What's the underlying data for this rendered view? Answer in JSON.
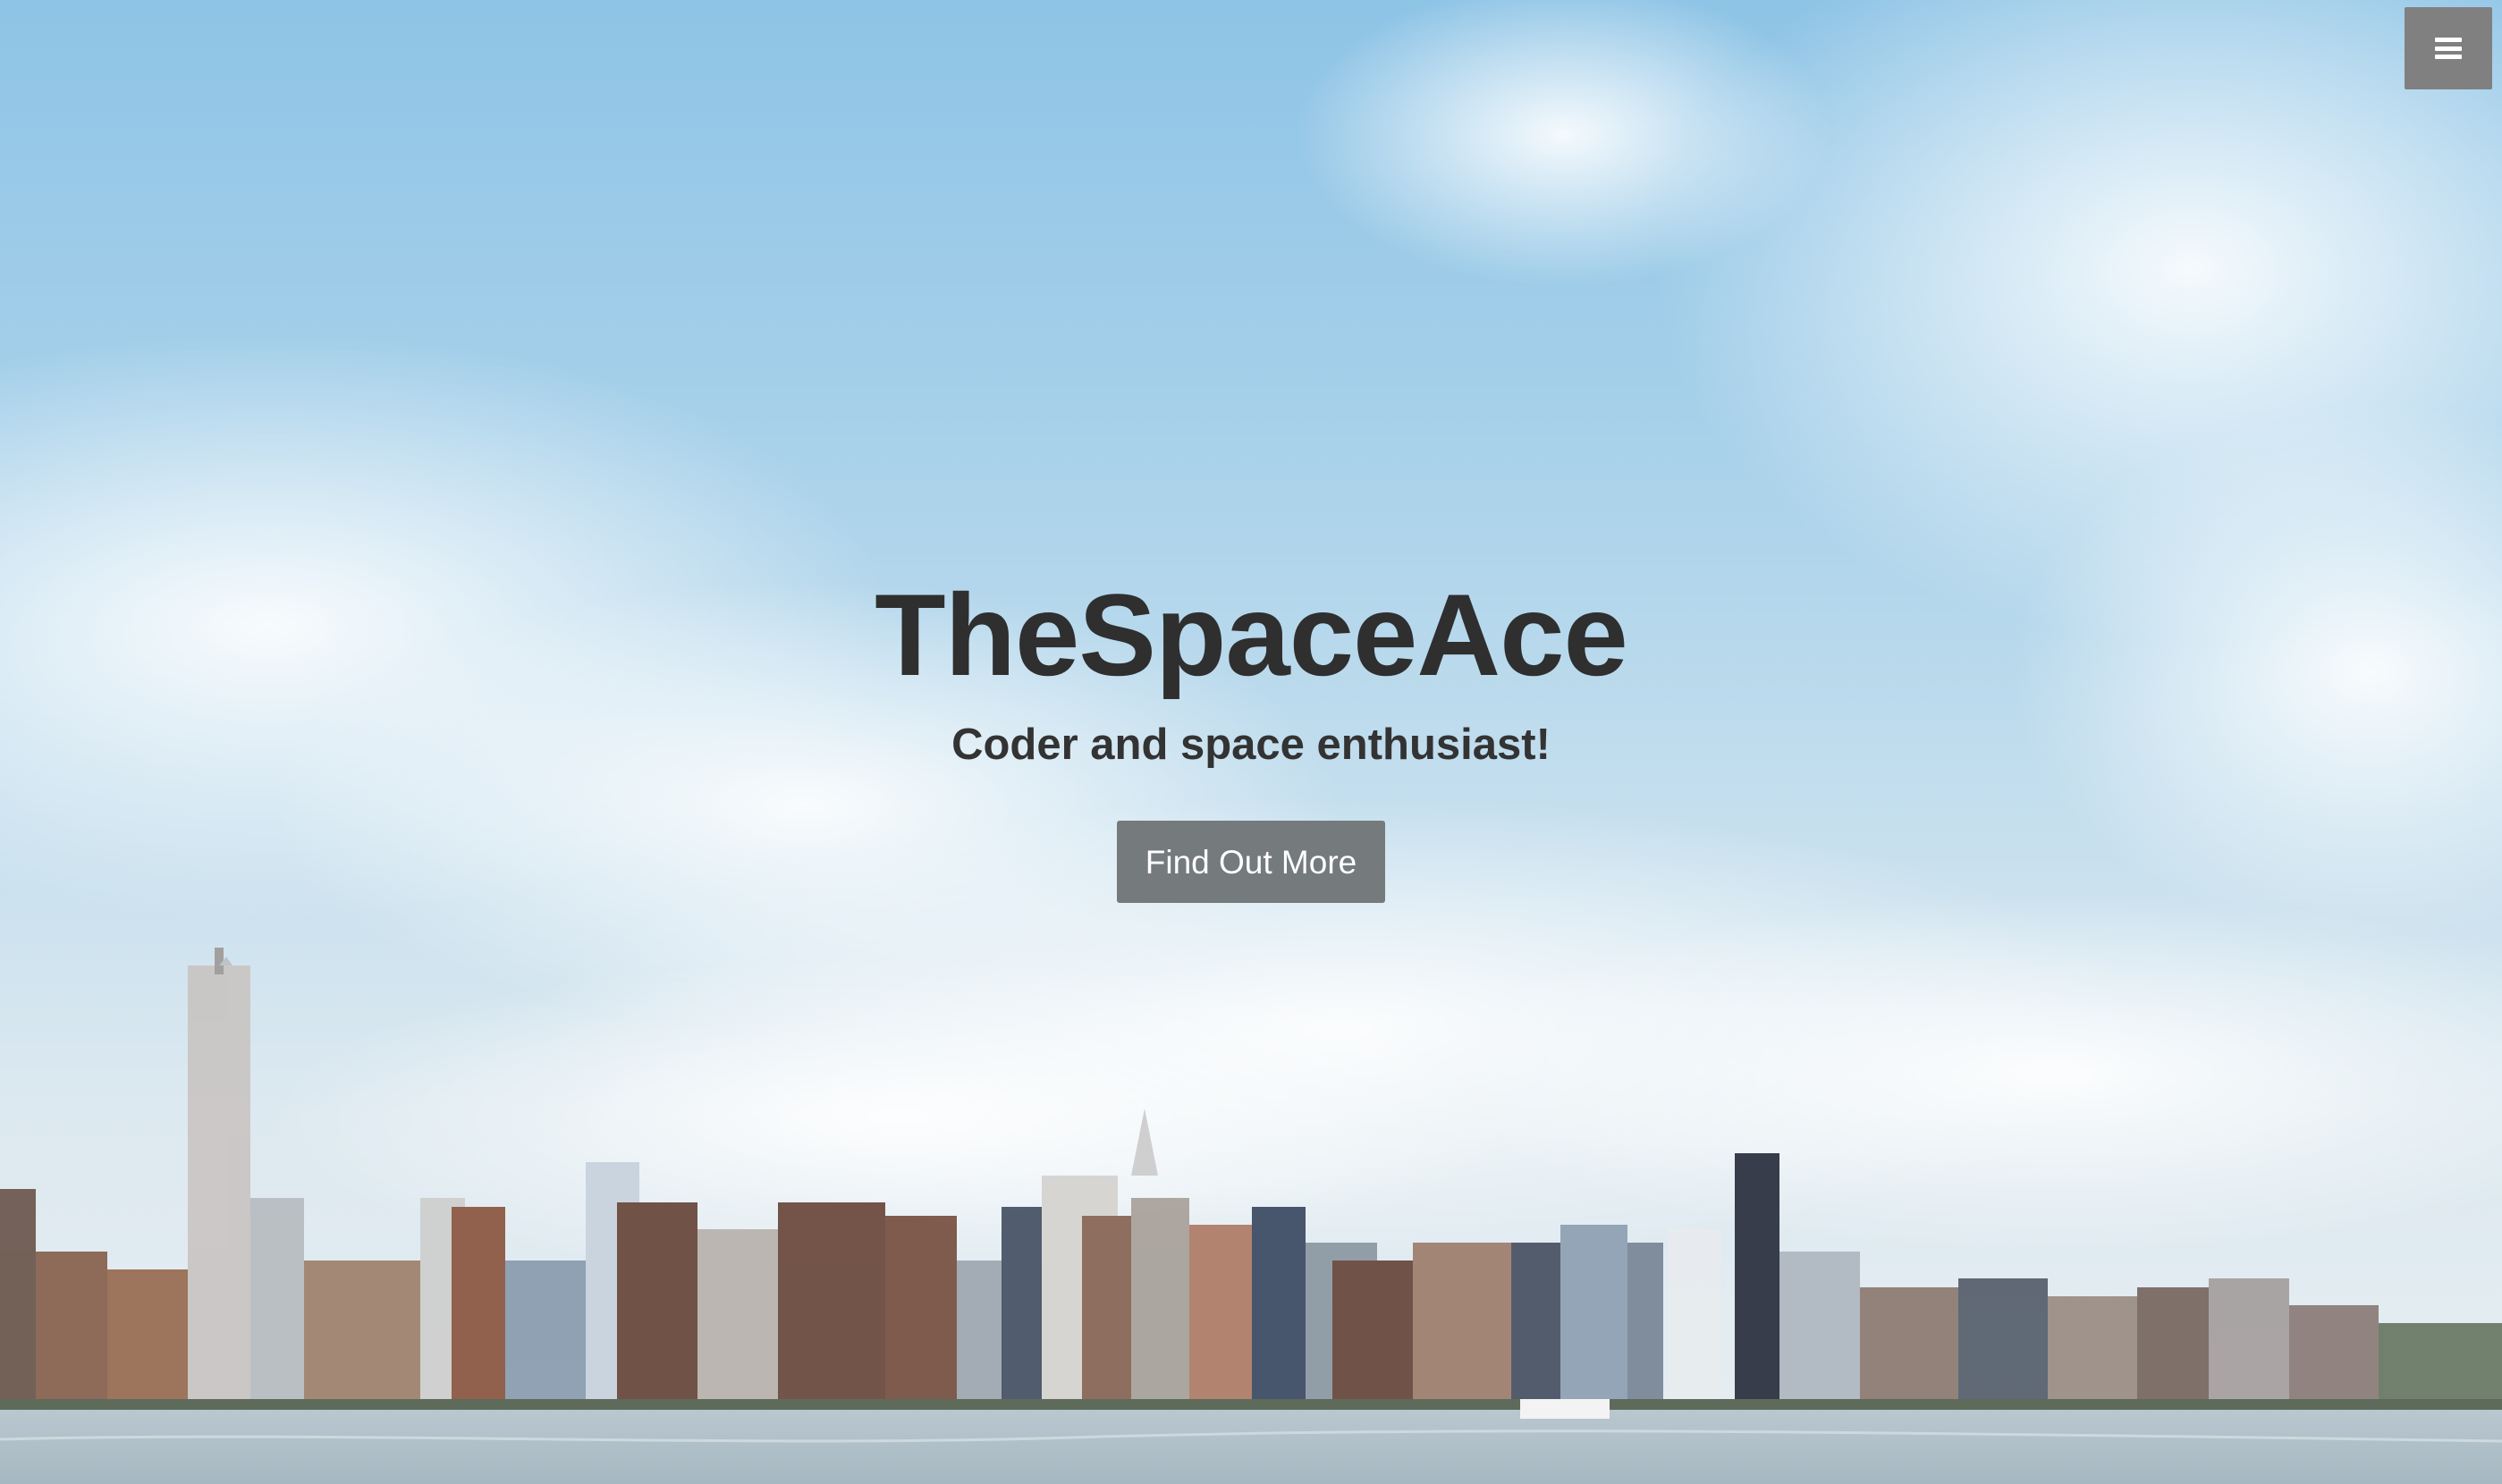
{
  "header": {
    "menu_icon": "hamburger-menu-icon"
  },
  "hero": {
    "title": "TheSpaceAce",
    "subtitle": "Coder and space enthusiast!",
    "cta_label": "Find Out More",
    "background": "city-skyline-photo"
  },
  "colors": {
    "title": "#2f2f2f",
    "button_bg": "#757a7c",
    "menu_bg": "#808080",
    "sky": "#8ec4e6"
  }
}
